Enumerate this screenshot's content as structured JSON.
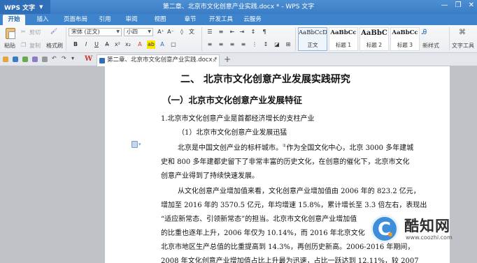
{
  "titlebar": {
    "app_label": "WPS 文字",
    "doc_title": "第二章、北京市文化创意产业实践.docx * - WPS 文字",
    "controls": [
      "—",
      "❐",
      "✕"
    ]
  },
  "menu": {
    "tabs": [
      "开始",
      "插入",
      "页面布局",
      "引用",
      "审阅",
      "视图",
      "章节",
      "开发工具",
      "云服务"
    ]
  },
  "ribbon": {
    "paste": "粘贴",
    "cut": "剪切",
    "copy": "复制",
    "format_painter": "格式刷",
    "font_name": "宋体 (正文)",
    "font_size": "小四",
    "bold": "B",
    "italic": "I",
    "underline": "U",
    "styles": [
      {
        "sample": "AaBbCcDd",
        "name": "正文"
      },
      {
        "sample": "AaBbCc",
        "name": "标题 1"
      },
      {
        "sample": "AaBbC",
        "name": "标题 2"
      },
      {
        "sample": "AaBbCc",
        "name": "标题 3"
      }
    ],
    "new_style": "新样式",
    "text_tools": "文字工具"
  },
  "tabbar": {
    "doc_tab": "第二章、北京市文化创意产业实践.docx *",
    "new_tab": "+"
  },
  "document": {
    "h1": "二、  北京市文化创意产业发展实践研究",
    "h2": "（一）北京市文化创意产业发展特征",
    "h3": "1.北京市文化创意产业是首都经济增长的支柱产业",
    "h4": "（1）北京市文化创意产业发展迅猛",
    "lines": [
      "北京是中国文创产业的标杆城市。",
      "作为全国文化中心，北京 3000 多年建城",
      "史和 800 多年建都史留下了非常丰富的历史文化，在创意的催化下，北京市文化",
      "创意产业得到了持续快速发展。",
      "从文化创意产业增加值来看，文化创意产业增加值由 2006 年的 823.2 亿元，",
      "增加至 2016 年的 3570.5 亿元，年均增速 15.8%，累计增长至 3.3 倍左右，表现出",
      "“适应新常态、引领新常态”的担当。北京市文化创意产业增加值",
      "的比重也逐年上升，2006 年仅为 10.14%，而 2016 年北京文化",
      "北京市地区生产总值的比重提高到 14.3%，再创历史新高。2006-2016 年期间，",
      "2008 年文化创意产业增加值占比上升最为迅速，占比一跃达到 12.11%，较 2007"
    ],
    "footnote_mark": "①"
  },
  "watermark": {
    "brand": "酷知网",
    "url": "www.coozhi.com"
  }
}
